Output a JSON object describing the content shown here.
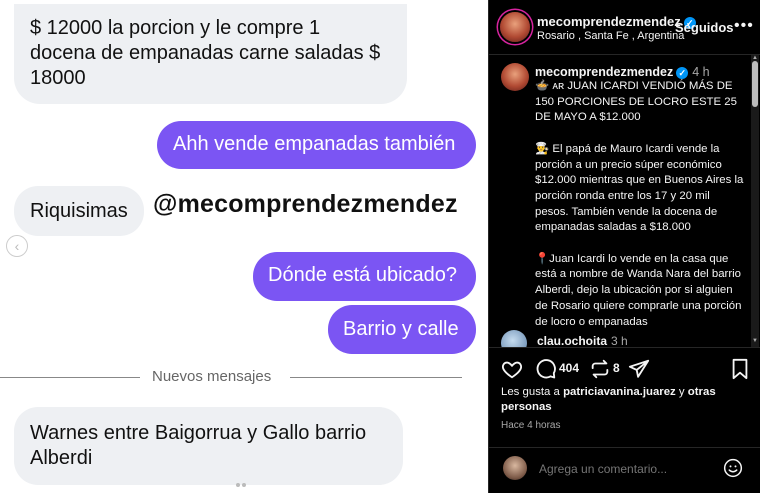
{
  "chat": {
    "messages": [
      {
        "side": "in",
        "text": "$ 12000 la porcion y le compre 1 docena de empanadas carne saladas $ 18000"
      },
      {
        "side": "out",
        "text": "Ahh vende empanadas también"
      },
      {
        "side": "in",
        "text": "Riquisimas"
      },
      {
        "side": "out",
        "text": "Dónde está ubicado?"
      },
      {
        "side": "out",
        "text": "Barrio y calle"
      },
      {
        "side": "in",
        "text": "Warnes  entre Baigorrua y Gallo  barrio Alberdi"
      }
    ],
    "watermark": "@mecomprendezmendez",
    "divider_label": "Nuevos mensajes",
    "prev_arrow": "‹"
  },
  "post": {
    "header": {
      "username": "mecomprendezmendez",
      "verified_mark": "✓",
      "location": "Rosario , Santa Fe , Argentina",
      "follow_label": "Seguidos",
      "more_label": "•••"
    },
    "caption": {
      "username": "mecomprendezmendez",
      "time": "4 h",
      "text": "🍲 ᴀʀ JUAN ICARDI VENDIÓ MÁS DE 150 PORCIONES DE LOCRO ESTE 25 DE MAYO A $12.000\n\n👨‍🍳 El papá de Mauro Icardi vende la porción a un precio súper económico $12.000 mientras que en Buenos Aires la porción ronda entre los 17 y 20 mil pesos. También vende la docena de empanadas saladas a $18.000\n\n📍Juan Icardi lo vende en la casa que está a nombre de Wanda Nara del barrio Alberdi, dejo la ubicación por si alguien de Rosario quiere comprarle una porción de locro o empanadas"
    },
    "comment": {
      "username": "clau.ochoita",
      "time": "3 h"
    },
    "actions": {
      "comment_count": "404",
      "repost_count": "8"
    },
    "likes": {
      "prefix": "Les gusta a ",
      "user": "patriciavanina.juarez",
      "suffix": " y ",
      "others": "otras personas"
    },
    "ago": "Hace 4 horas",
    "composer": {
      "placeholder": "Agrega un comentario..."
    }
  }
}
